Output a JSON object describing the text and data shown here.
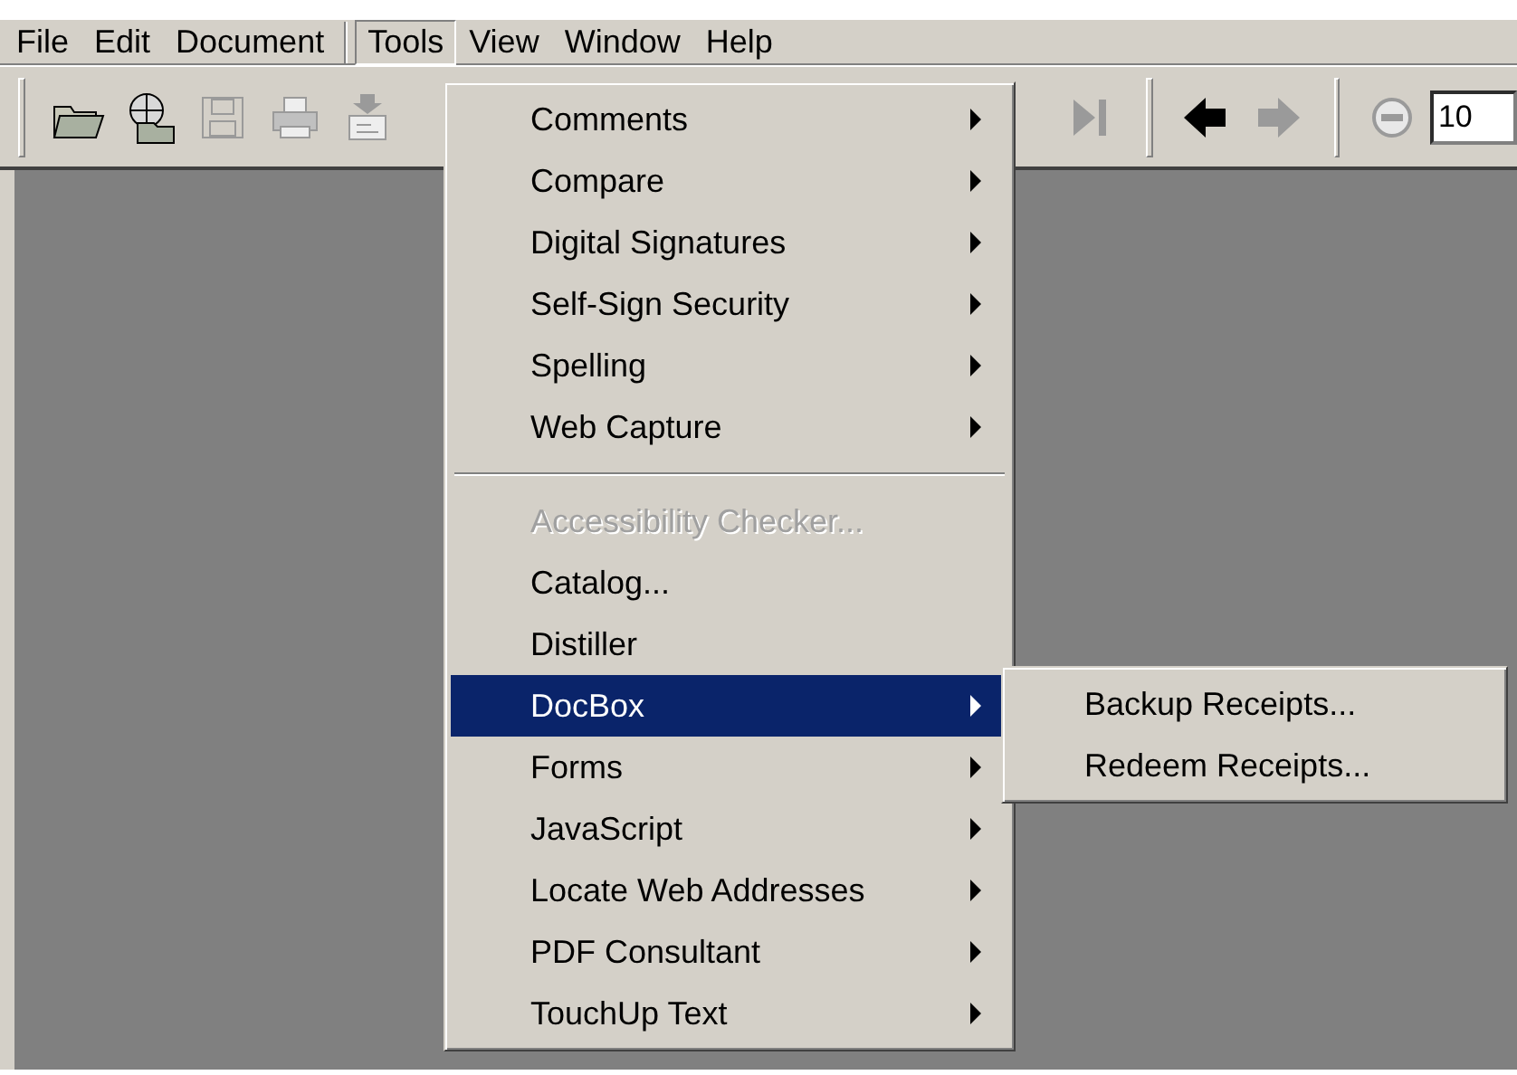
{
  "menu_bar": [
    {
      "label": "File",
      "selected": false
    },
    {
      "label": "Edit",
      "selected": false
    },
    {
      "label": "Document",
      "selected": false
    },
    {
      "label": "Tools",
      "selected": true
    },
    {
      "label": "View",
      "selected": false
    },
    {
      "label": "Window",
      "selected": false
    },
    {
      "label": "Help",
      "selected": false
    }
  ],
  "toolbar": {
    "left": [
      {
        "kind": "open",
        "disabled": false
      },
      {
        "kind": "web",
        "disabled": false
      },
      {
        "kind": "save",
        "disabled": true
      },
      {
        "kind": "print",
        "disabled": true
      },
      {
        "kind": "mail",
        "disabled": true
      }
    ],
    "right": [
      {
        "kind": "last",
        "disabled": true
      },
      {
        "kind": "grip"
      },
      {
        "kind": "back",
        "disabled": false
      },
      {
        "kind": "forward",
        "disabled": true
      },
      {
        "kind": "grip"
      },
      {
        "kind": "zoomout",
        "disabled": true
      }
    ],
    "zoom_value": "10"
  },
  "tools_menu": [
    {
      "label": "Comments",
      "submenu": true,
      "disabled": false,
      "selected": false
    },
    {
      "label": "Compare",
      "submenu": true,
      "disabled": false,
      "selected": false
    },
    {
      "label": "Digital Signatures",
      "submenu": true,
      "disabled": false,
      "selected": false
    },
    {
      "label": "Self-Sign Security",
      "submenu": true,
      "disabled": false,
      "selected": false
    },
    {
      "label": "Spelling",
      "submenu": true,
      "disabled": false,
      "selected": false
    },
    {
      "label": "Web Capture",
      "submenu": true,
      "disabled": false,
      "selected": false
    },
    {
      "kind": "separator"
    },
    {
      "label": "Accessibility Checker...",
      "submenu": false,
      "disabled": true,
      "selected": false
    },
    {
      "label": "Catalog...",
      "submenu": false,
      "disabled": false,
      "selected": false
    },
    {
      "label": "Distiller",
      "submenu": false,
      "disabled": false,
      "selected": false
    },
    {
      "label": "DocBox",
      "submenu": true,
      "disabled": false,
      "selected": true
    },
    {
      "label": "Forms",
      "submenu": true,
      "disabled": false,
      "selected": false
    },
    {
      "label": "JavaScript",
      "submenu": true,
      "disabled": false,
      "selected": false
    },
    {
      "label": "Locate Web Addresses",
      "submenu": true,
      "disabled": false,
      "selected": false
    },
    {
      "label": "PDF Consultant",
      "submenu": true,
      "disabled": false,
      "selected": false
    },
    {
      "label": "TouchUp Text",
      "submenu": true,
      "disabled": false,
      "selected": false
    }
  ],
  "docbox_submenu": [
    {
      "label": "Backup Receipts...",
      "selected": false
    },
    {
      "label": "Redeem Receipts...",
      "selected": false
    }
  ]
}
